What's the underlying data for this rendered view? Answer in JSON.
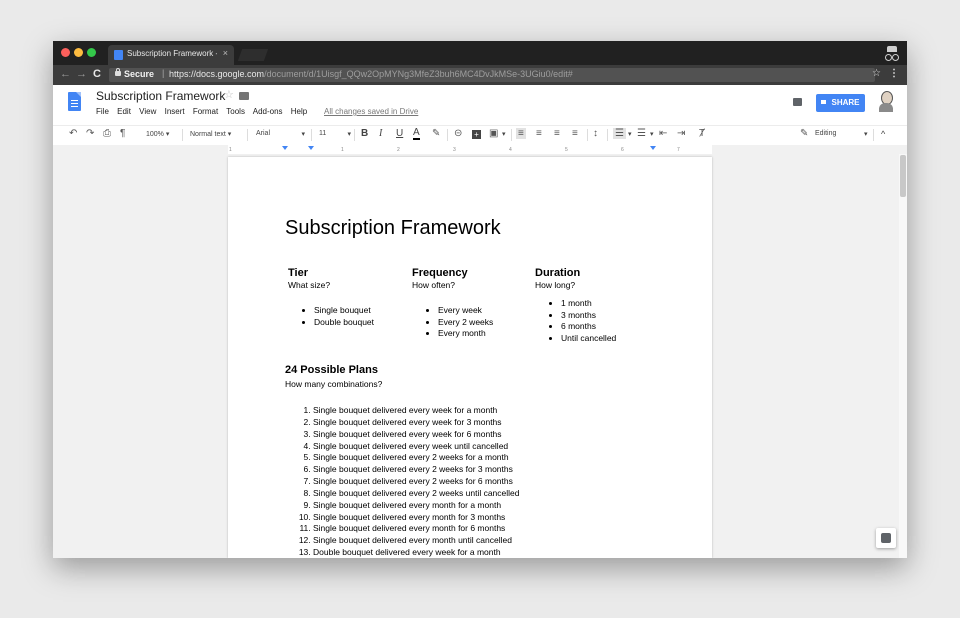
{
  "browser": {
    "tab_title": "Subscription Framework - Goo",
    "tab_close": "×",
    "secure_label": "Secure",
    "url_domain": "https://docs.google.com",
    "url_path": "/document/d/1Uisgf_QQw2OpMYNg3MfeZ3buh6MC4DvJkMSe-3UGiu0/edit#",
    "back": "←",
    "forward": "→",
    "reload": "C",
    "separator": "|",
    "star": "☆",
    "menu": "⋮"
  },
  "docs": {
    "title": "Subscription Framework",
    "title_star": "☆",
    "menu": [
      "File",
      "Edit",
      "View",
      "Insert",
      "Format",
      "Tools",
      "Add-ons",
      "Help"
    ],
    "saved_status": "All changes saved in Drive",
    "share_label": "SHARE"
  },
  "toolbar": {
    "undo": "↶",
    "redo": "↷",
    "print": "⎙",
    "paint_format": "¶",
    "zoom": "100%",
    "style": "Normal text",
    "font": "Arial",
    "size": "11",
    "bold": "B",
    "italic": "I",
    "underline": "U",
    "text_color": "A",
    "highlight": "✎",
    "link": "⊝",
    "comment": "+",
    "image": "▣",
    "align_left": "≡",
    "align_center": "≡",
    "align_right": "≡",
    "justify": "≡",
    "line_spacing": "↕",
    "numbered_list": "☰",
    "bulleted_list": "☰",
    "decrease_indent": "⇤",
    "increase_indent": "⇥",
    "clear_format": "Ⱦ",
    "caret": "▾",
    "mode": "Editing",
    "mode_icon": "✎",
    "collapse": "^"
  },
  "ruler": {
    "ticks": [
      "1",
      "1",
      "2",
      "3",
      "4",
      "5",
      "6",
      "7"
    ]
  },
  "document": {
    "heading": "Subscription Framework",
    "tier": {
      "heading": "Tier",
      "question": "What size?",
      "items": [
        "Single bouquet",
        "Double bouquet"
      ]
    },
    "frequency": {
      "heading": "Frequency",
      "question": "How often?",
      "items": [
        "Every week",
        "Every 2 weeks",
        "Every month"
      ]
    },
    "duration": {
      "heading": "Duration",
      "question": "How long?",
      "items": [
        "1 month",
        "3 months",
        "6 months",
        "Until cancelled"
      ]
    },
    "plans_heading": "24 Possible Plans",
    "plans_question": "How many combinations?",
    "plans": [
      "Single bouquet delivered every week for a month",
      "Single bouquet delivered every week for 3 months",
      "Single bouquet delivered every week for 6 months",
      "Single bouquet delivered every week until cancelled",
      "Single bouquet delivered every 2 weeks for a month",
      "Single bouquet delivered every 2 weeks for 3 months",
      "Single bouquet delivered every 2 weeks for 6 months",
      "Single bouquet delivered every 2 weeks until cancelled",
      "Single bouquet delivered every month for a month",
      "Single bouquet delivered every month for 3 months",
      "Single bouquet delivered every month for 6 months",
      "Single bouquet delivered every month until cancelled",
      "Double bouquet delivered every week for a month"
    ]
  },
  "colors": {
    "accent": "#4285f4",
    "chrome_dark": "#212121",
    "canvas": "#f1f1f1"
  }
}
